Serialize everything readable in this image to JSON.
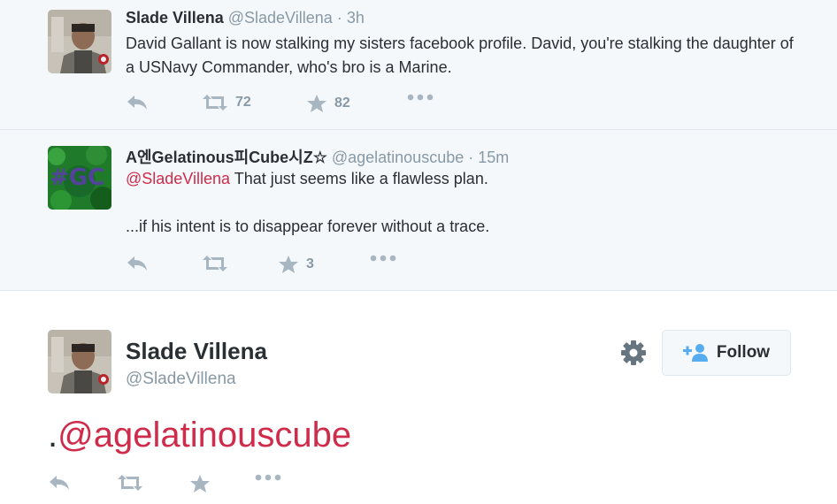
{
  "tweets": [
    {
      "fullname": "Slade Villena",
      "username": "@SladeVillena",
      "separator": "·",
      "time": "3h",
      "text": "David Gallant is now stalking my sisters facebook profile. David, you're stalking the daughter of a USNavy Commander, who's bro is a Marine.",
      "retweets": "72",
      "favorites": "82"
    },
    {
      "fullname": "A엔Gelatinous피Cube시Z☆",
      "username": "@agelatinouscube",
      "separator": "·",
      "time": "15m",
      "mention": "@SladeVillena",
      "text_after_mention": " That just seems like a flawless plan.",
      "text_second": "...if his intent is to disappear forever without a trace.",
      "favorites": "3"
    }
  ],
  "main": {
    "fullname": "Slade Villena",
    "username": "@SladeVillena",
    "follow_label": "Follow",
    "text_prefix": ".",
    "text_mention": "@agelatinouscube"
  },
  "icons": {
    "reply": "reply-icon",
    "retweet": "retweet-icon",
    "favorite": "star-icon",
    "more": "more-icon",
    "gear": "gear-icon",
    "follow": "add-user-icon"
  },
  "colors": {
    "mention": "#cf2b4a",
    "thread_bg": "#f5f8fa",
    "muted": "#8899a6"
  }
}
